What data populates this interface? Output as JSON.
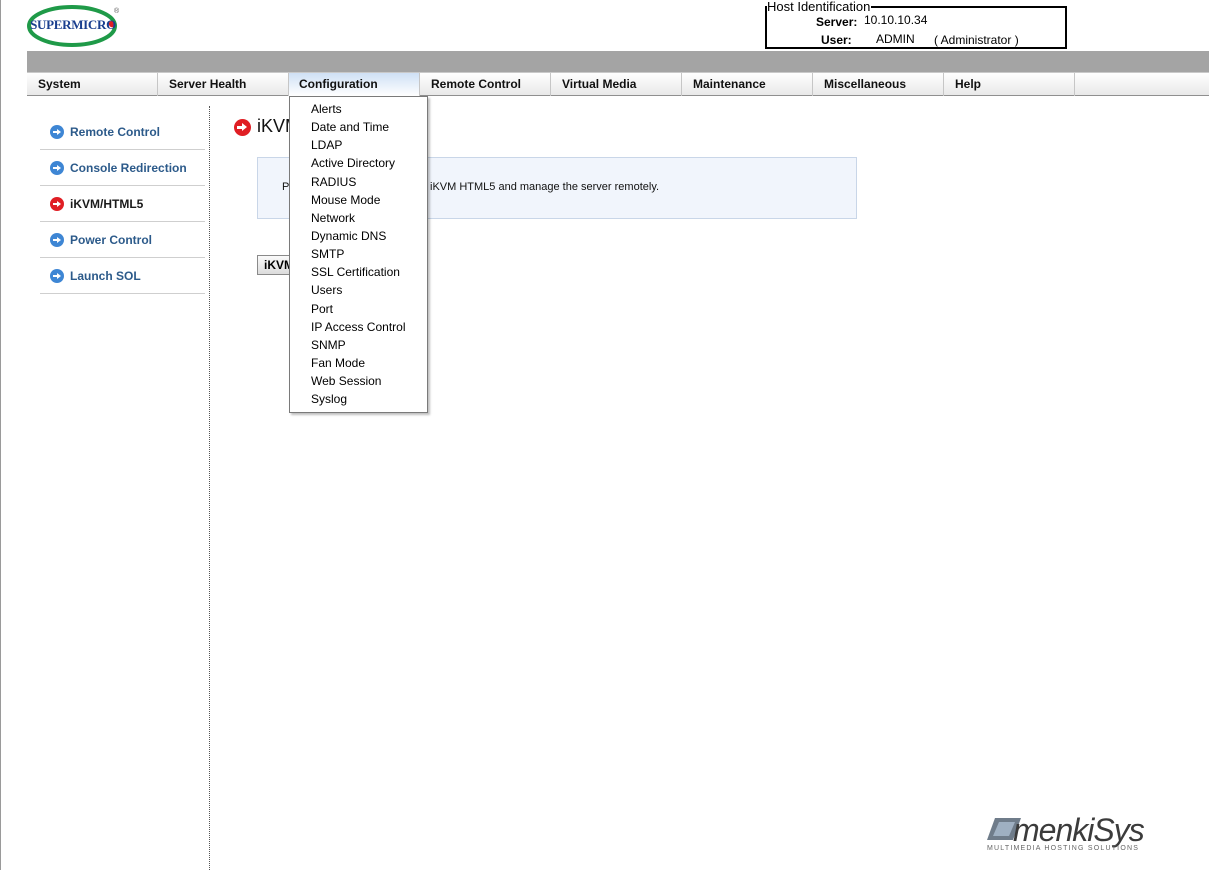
{
  "logo": {
    "text": "SUPERMICRO",
    "reg": "®"
  },
  "host": {
    "legend": "Host Identification",
    "server_label": "Server:",
    "server_value": "10.10.10.34",
    "user_label": "User:",
    "user_value": "ADMIN",
    "user_role": "( Administrator )"
  },
  "nav": {
    "items": [
      {
        "label": "System"
      },
      {
        "label": "Server Health"
      },
      {
        "label": "Configuration"
      },
      {
        "label": "Remote Control"
      },
      {
        "label": "Virtual Media"
      },
      {
        "label": "Maintenance"
      },
      {
        "label": "Miscellaneous"
      },
      {
        "label": "Help"
      }
    ],
    "active": "Configuration"
  },
  "sidebar": {
    "items": [
      {
        "label": "Remote Control"
      },
      {
        "label": "Console Redirection"
      },
      {
        "label": "iKVM/HTML5"
      },
      {
        "label": "Power Control"
      },
      {
        "label": "Launch SOL"
      }
    ],
    "selected": "iKVM/HTML5"
  },
  "main": {
    "title": "iKVM",
    "info_prefix": "P",
    "info_text": "iKVM HTML5 and manage the server remotely.",
    "button_label": "iKVM"
  },
  "dropdown": {
    "items": [
      {
        "label": "Alerts"
      },
      {
        "label": "Date and Time"
      },
      {
        "label": "LDAP"
      },
      {
        "label": "Active Directory"
      },
      {
        "label": "RADIUS"
      },
      {
        "label": "Mouse Mode"
      },
      {
        "label": "Network"
      },
      {
        "label": "Dynamic DNS"
      },
      {
        "label": "SMTP"
      },
      {
        "label": "SSL Certification"
      },
      {
        "label": "Users"
      },
      {
        "label": "Port"
      },
      {
        "label": "IP Access Control"
      },
      {
        "label": "SNMP"
      },
      {
        "label": "Fan Mode"
      },
      {
        "label": "Web Session"
      },
      {
        "label": "Syslog"
      }
    ]
  },
  "watermark": {
    "text": "menkiSys",
    "sub": "MULTIMEDIA HOSTING SOLUTIONS"
  },
  "colors": {
    "accent": "#3e86d4",
    "active_marker": "#e01e24",
    "nav_band": "#a4a4a4"
  }
}
